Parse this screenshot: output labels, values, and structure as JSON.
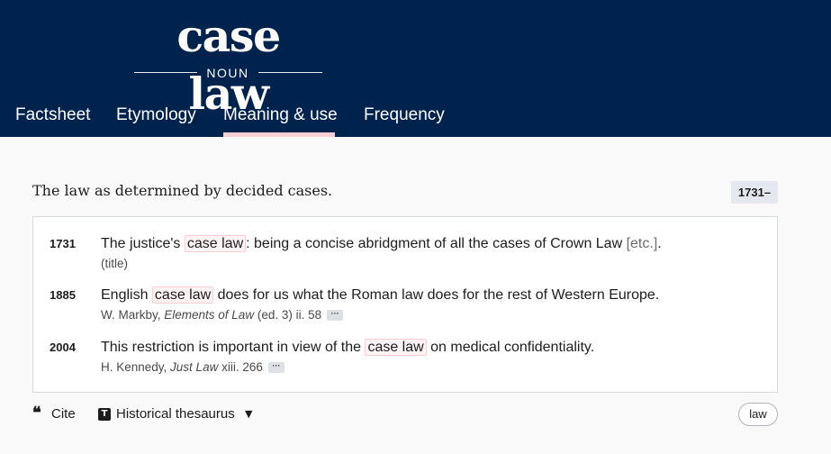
{
  "entry": {
    "headword": "case law",
    "part_of_speech": "NOUN"
  },
  "tabs": [
    {
      "label": "Factsheet",
      "active": false
    },
    {
      "label": "Etymology",
      "active": false
    },
    {
      "label": "Meaning & use",
      "active": true
    },
    {
      "label": "Frequency",
      "active": false
    }
  ],
  "sense": {
    "definition": "The law as determined by decided cases.",
    "date_range": "1731–"
  },
  "quotations": [
    {
      "year": "1731",
      "text_before": "The justice's ",
      "keyword": "case law",
      "text_after": ": being a concise abridgment of all the cases of Crown Law ",
      "bracket_note": "[etc.]",
      "text_end": ".",
      "citation": "(title)"
    },
    {
      "year": "1885",
      "text_before": "English ",
      "keyword": "case law",
      "text_after": " does for us what the Roman law does for the rest of Western Europe.",
      "citation_author": "W. Markby, ",
      "citation_work": "Elements of Law",
      "citation_rest": " (ed. 3) ii. 58",
      "more": "···"
    },
    {
      "year": "2004",
      "text_before": "This restriction is important in view of the ",
      "keyword": "case law",
      "text_after": " on medical confidentiality.",
      "citation_author": "H. Kennedy, ",
      "citation_work": "Just Law",
      "citation_rest": " xiii. 266",
      "more": "···"
    }
  ],
  "footer": {
    "cite_icon": "quote-icon",
    "cite_label": "Cite",
    "thesaurus_icon": "T",
    "thesaurus_label": "Historical thesaurus",
    "thesaurus_caret": "▼",
    "tag": "law"
  },
  "colors": {
    "header_bg": "#00234e",
    "active_tab_underline": "#f9cfd4",
    "keyword_highlight_border": "#f9cfd4"
  }
}
